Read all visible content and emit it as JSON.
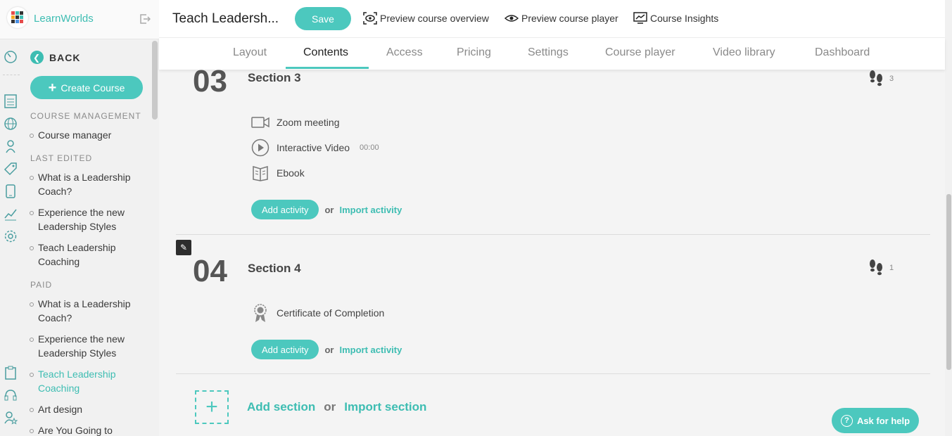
{
  "brand": {
    "name": "LearnWorlds",
    "accent": "#4cc8be"
  },
  "sidebar": {
    "back_label": "BACK",
    "create_label": "Create Course",
    "groups": [
      {
        "heading": "COURSE MANAGEMENT",
        "items": [
          "Course manager"
        ]
      },
      {
        "heading": "LAST EDITED",
        "items": [
          "What is a Leadership Coach?",
          "Experience the new Leadership Styles",
          "Teach Leadership Coaching"
        ]
      },
      {
        "heading": "PAID",
        "items": [
          "What is a Leadership Coach?",
          "Experience the new Leadership Styles",
          "Teach Leadership Coaching",
          "Art design",
          "Are You Going to"
        ]
      }
    ]
  },
  "header": {
    "course_title": "Teach Leadersh...",
    "save_label": "Save",
    "links": [
      "Preview course overview",
      "Preview course player",
      "Course Insights"
    ]
  },
  "tabs": [
    "Layout",
    "Contents",
    "Access",
    "Pricing",
    "Settings",
    "Course player",
    "Video library",
    "Dashboard"
  ],
  "active_tab": "Contents",
  "sections": [
    {
      "number": "03",
      "title": "Section 3",
      "steps": "3",
      "activities": [
        {
          "icon": "video-camera-icon",
          "label": "Zoom meeting",
          "duration": ""
        },
        {
          "icon": "play-circle-icon",
          "label": "Interactive Video",
          "duration": "00:00"
        },
        {
          "icon": "book-icon",
          "label": "Ebook",
          "duration": ""
        }
      ]
    },
    {
      "number": "04",
      "title": "Section 4",
      "steps": "1",
      "activities": [
        {
          "icon": "certificate-icon",
          "label": "Certificate of Completion",
          "duration": ""
        }
      ]
    }
  ],
  "add_activity_label": "Add activity",
  "or_label": "or",
  "import_activity_label": "Import activity",
  "add_section_label": "Add section",
  "import_section_label": "Import section",
  "help_label": "Ask for help"
}
